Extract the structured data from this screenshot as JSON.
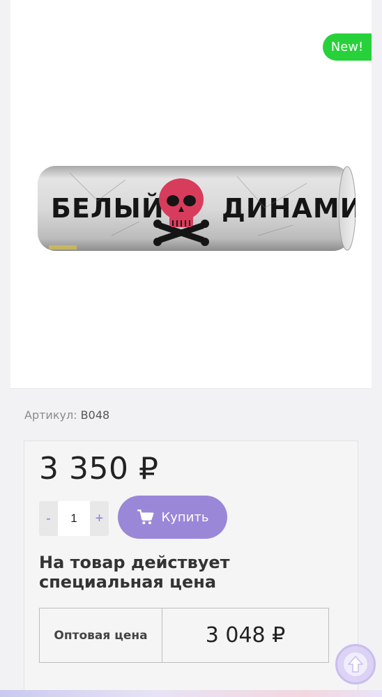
{
  "product": {
    "badge": "New!",
    "image_alt_text_printed": [
      "БЕЛЫЙ",
      "ДИНАМИТ"
    ],
    "sku_label": "Артикул:",
    "sku_value": "B048",
    "price": "3 350 ₽"
  },
  "cart": {
    "minus_label": "-",
    "quantity": "1",
    "plus_label": "+",
    "buy_label": "Купить",
    "buy_icon": "cart-icon"
  },
  "special_offer": {
    "heading": "На товар действует специальная цена",
    "wholesale_label": "Оптовая цена",
    "wholesale_price": "3 048 ₽"
  },
  "scroll_top_icon": "arrow-up-icon",
  "colors": {
    "badge_bg": "#27d13a",
    "buy_button": "#9a87d8",
    "qty_accent": "#8b7fd6"
  }
}
